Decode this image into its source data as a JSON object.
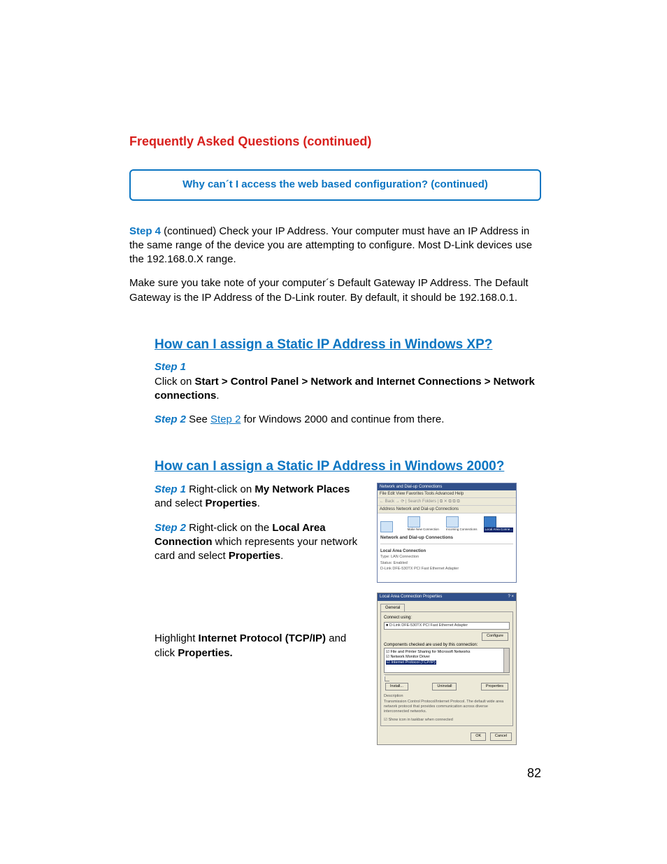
{
  "header": {
    "faq_title": "Frequently Asked Questions (continued)",
    "callout": "Why can´t I access the web based configuration? (continued)"
  },
  "intro": {
    "step4_label": "Step 4",
    "step4_cont": " (continued) ",
    "step4_text": "Check your IP Address. Your computer must have an IP Address in the same range of the device you are attempting to configure. Most D-Link devices use the 192.168.0.X range.",
    "gateway_text": "Make sure you take note of your computer´s Default Gateway IP Address. The Default Gateway is the IP Address of the D-Link router. By default, it should be 192.168.0.1."
  },
  "xp": {
    "title": "How can I assign a Static IP Address in Windows XP?",
    "step1_label": "Step 1",
    "step1_pre": "Click on ",
    "step1_bold": "Start > Control Panel > Network and Internet Connections > Network connections",
    "step1_post": ".",
    "step2_label": "Step 2",
    "step2_pre": " See ",
    "step2_link": "Step 2",
    "step2_post": " for Windows 2000 and continue from there."
  },
  "w2k": {
    "title": "How can I assign a Static IP Address in Windows 2000?",
    "step1_label": "Step 1",
    "step1_pre": " Right-click on ",
    "step1_bold1": "My Network Places",
    "step1_mid": " and select ",
    "step1_bold2": "Properties",
    "step1_post": ".",
    "step2_label": "Step 2",
    "step2_pre": " Right-click on the ",
    "step2_bold1": "Local Area Connection",
    "step2_mid": " which represents your network card and select ",
    "step2_bold2": "Properties",
    "step2_post": ".",
    "tcpip_pre": "Highlight ",
    "tcpip_bold1": "Internet Protocol (TCP/IP)",
    "tcpip_mid": " and click ",
    "tcpip_bold2": "Properties.",
    "tcpip_post": ""
  },
  "screenshot1": {
    "title": "Network and Dial-up Connections",
    "menu": "File   Edit   View   Favorites   Tools   Advanced   Help",
    "toolbar": "← Back  →  ⟳  |  Search   Folders   |  ⧉  ✕  ⧉  ⧉  ⧉",
    "address": "Address  Network and Dial-up Connections",
    "icon_labels": [
      "Make New Connection",
      "Incoming Connections",
      "Local Area Conne..."
    ],
    "heading": "Network and Dial-up Connections",
    "sub": "Local Area Connection",
    "line1": "Type: LAN Connection",
    "line2": "Status: Enabled",
    "line3": "D-Link DFE-530TX PCI Fast Ethernet Adapter"
  },
  "screenshot2": {
    "title": "Local Area Connection Properties",
    "close": "? ×",
    "tab": "General",
    "connect_label": "Connect using:",
    "adapter": "D-Link DFE-530TX PCI Fast Ethernet Adapter",
    "configure": "Configure",
    "components": "Components checked are used by this connection:",
    "list": [
      "☑ File and Printer Sharing for Microsoft Networks",
      "☑ Network Monitor Driver"
    ],
    "list_selected": "☑ Internet Protocol (TCP/IP)",
    "install": "Install...",
    "uninstall": "Uninstall",
    "properties": "Properties",
    "desc_label": "Description",
    "desc": "Transmission Control Protocol/Internet Protocol. The default wide area network protocol that provides communication across diverse interconnected networks.",
    "show_icon": "☑ Show icon in taskbar when connected",
    "ok": "OK",
    "cancel": "Cancel"
  },
  "page_number": "82"
}
